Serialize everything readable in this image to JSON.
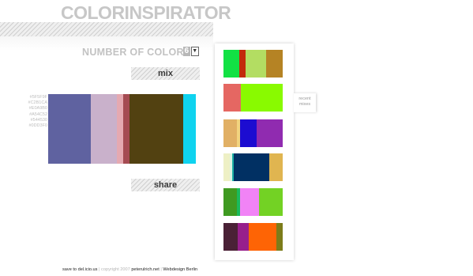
{
  "app": {
    "title": "COLORINSPIRATOR"
  },
  "controls": {
    "count_label": "NUMBER OF COLORS",
    "count_value": "6",
    "mix_label": "mix",
    "share_label": "share"
  },
  "palette": {
    "hex_codes": [
      "#5F5F9F",
      "#C2B1CA",
      "#E0A9B0",
      "#A54C52",
      "#544530",
      "#0DD3F0"
    ],
    "swatches": [
      {
        "color": "#5f62a0",
        "weight": 54
      },
      {
        "color": "#c9b1cb",
        "weight": 33
      },
      {
        "color": "#e5a9b1",
        "weight": 8
      },
      {
        "color": "#a54b52",
        "weight": 8
      },
      {
        "color": "#524111",
        "weight": 68
      },
      {
        "color": "#0fd3ef",
        "weight": 16
      }
    ]
  },
  "history": {
    "tab_label": "recent mixes",
    "mixes": [
      [
        {
          "color": "#12e144",
          "weight": 20
        },
        {
          "color": "#c22a0b",
          "weight": 8
        },
        {
          "color": "#b3dd62",
          "weight": 26
        },
        {
          "color": "#b58324",
          "weight": 21
        }
      ],
      [
        {
          "color": "#e56762",
          "weight": 22
        },
        {
          "color": "#89fa00",
          "weight": 53
        }
      ],
      [
        {
          "color": "#e1b065",
          "weight": 17
        },
        {
          "color": "#f2d47f",
          "weight": 4
        },
        {
          "color": "#1c0cd1",
          "weight": 21
        },
        {
          "color": "#902bb0",
          "weight": 33
        }
      ],
      [
        {
          "color": "#eef0c5",
          "weight": 8
        },
        {
          "color": "#ddf2e1",
          "weight": 3
        },
        {
          "color": "#1bb0a6",
          "weight": 2
        },
        {
          "color": "#013063",
          "weight": 45
        },
        {
          "color": "#e0b550",
          "weight": 17
        }
      ],
      [
        {
          "color": "#3f9a21",
          "weight": 17
        },
        {
          "color": "#19bb5c",
          "weight": 4
        },
        {
          "color": "#f183f6",
          "weight": 24
        },
        {
          "color": "#73d224",
          "weight": 30
        }
      ],
      [
        {
          "color": "#4a2136",
          "weight": 18
        },
        {
          "color": "#971f8c",
          "weight": 14
        },
        {
          "color": "#fe6405",
          "weight": 35
        },
        {
          "color": "#7c7c1a",
          "weight": 8
        }
      ]
    ]
  },
  "footer": {
    "save_link": "save to del.icio.us",
    "sep1": "|",
    "copyright": "copyright 2007",
    "author_link": "peterulrich.net",
    "sep2": "|",
    "credit": "Webdesign Berlin"
  }
}
